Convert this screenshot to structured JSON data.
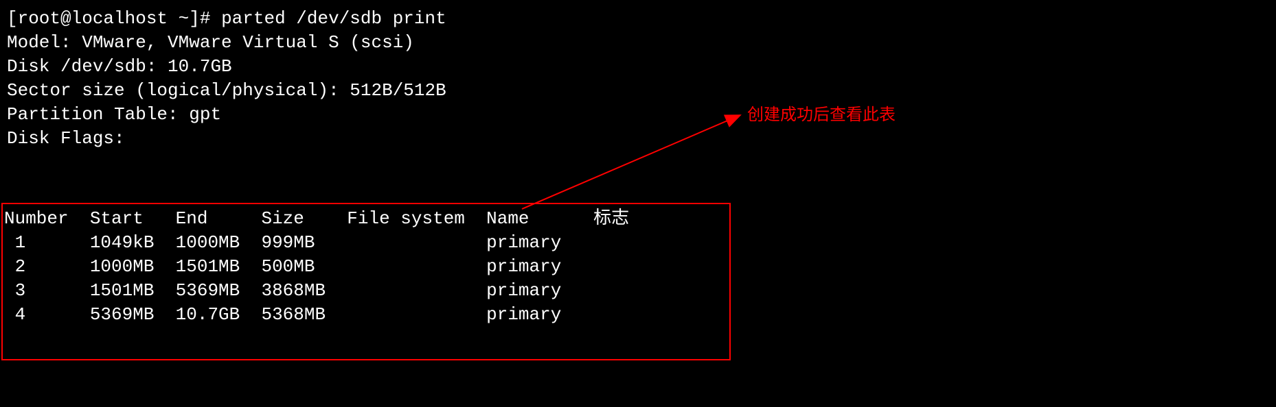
{
  "prompt": "[root@localhost ~]# ",
  "command": "parted /dev/sdb print",
  "output": {
    "model": "Model: VMware, VMware Virtual S (scsi)",
    "disk": "Disk /dev/sdb: 10.7GB",
    "sector": "Sector size (logical/physical): 512B/512B",
    "ptable": "Partition Table: gpt",
    "dflags": "Disk Flags:"
  },
  "table": {
    "headers": {
      "number": "Number",
      "start": "Start",
      "end": "End",
      "size": "Size",
      "fs": "File system",
      "name": "Name",
      "flags": "标志"
    },
    "rows": [
      {
        "number": "1",
        "start": "1049kB",
        "end": "1000MB",
        "size": "999MB",
        "fs": "",
        "name": "primary",
        "flags": ""
      },
      {
        "number": "2",
        "start": "1000MB",
        "end": "1501MB",
        "size": "500MB",
        "fs": "",
        "name": "primary",
        "flags": ""
      },
      {
        "number": "3",
        "start": "1501MB",
        "end": "5369MB",
        "size": "3868MB",
        "fs": "",
        "name": "primary",
        "flags": ""
      },
      {
        "number": "4",
        "start": "5369MB",
        "end": "10.7GB",
        "size": "5368MB",
        "fs": "",
        "name": "primary",
        "flags": ""
      }
    ]
  },
  "annotation": "创建成功后查看此表"
}
